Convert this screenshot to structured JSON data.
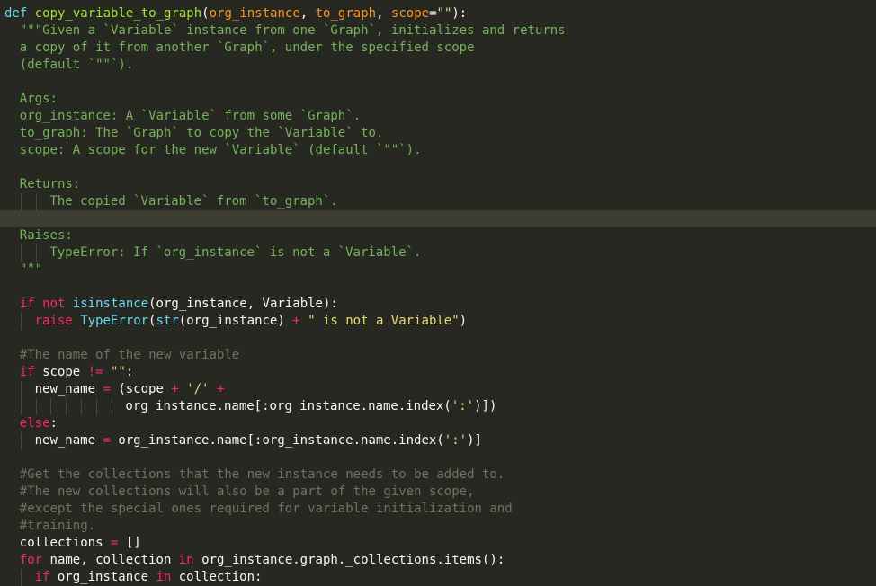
{
  "editor": {
    "language": "python",
    "theme_colors": {
      "background": "#272822",
      "active_line": "#3e3d32",
      "text": "#f8f8f2",
      "keyword": "#f92672",
      "def": "#66d9ef",
      "function": "#a6e22e",
      "parameter": "#fd971f",
      "string": "#e6db74",
      "docstring": "#75b35a",
      "comment": "#75715e",
      "indent_guide": "#464741"
    },
    "active_line_index": 12,
    "lines": [
      {
        "indent": 0,
        "tokens": [
          [
            "def",
            "def"
          ],
          [
            "t",
            " "
          ],
          [
            "fn",
            "copy_variable_to_graph"
          ],
          [
            "t",
            "("
          ],
          [
            "param",
            "org_instance"
          ],
          [
            "t",
            ", "
          ],
          [
            "param",
            "to_graph"
          ],
          [
            "t",
            ", "
          ],
          [
            "param",
            "scope"
          ],
          [
            "t",
            "="
          ],
          [
            "str",
            "\"\""
          ],
          [
            "t",
            "):"
          ]
        ]
      },
      {
        "indent": 1,
        "tokens": [
          [
            "doc",
            "\"\"\"Given a `Variable` instance from one `Graph`, initializes and returns"
          ]
        ]
      },
      {
        "indent": 1,
        "tokens": [
          [
            "doc",
            "a copy of it from another `Graph`, under the specified scope"
          ]
        ]
      },
      {
        "indent": 1,
        "tokens": [
          [
            "doc",
            "(default `\"\"`)."
          ]
        ]
      },
      {
        "indent": 1,
        "tokens": []
      },
      {
        "indent": 1,
        "tokens": [
          [
            "doc",
            "Args:"
          ]
        ]
      },
      {
        "indent": 1,
        "tokens": [
          [
            "doc",
            "org_instance: A `Variable` from some `Graph`."
          ]
        ]
      },
      {
        "indent": 1,
        "tokens": [
          [
            "doc",
            "to_graph: The `Graph` to copy the `Variable` to."
          ]
        ]
      },
      {
        "indent": 1,
        "tokens": [
          [
            "doc",
            "scope: A scope for the new `Variable` (default `\"\"`)."
          ]
        ]
      },
      {
        "indent": 1,
        "tokens": []
      },
      {
        "indent": 1,
        "tokens": [
          [
            "doc",
            "Returns:"
          ]
        ]
      },
      {
        "indent": 3,
        "tokens": [
          [
            "doc",
            "The copied `Variable` from `to_graph`."
          ]
        ]
      },
      {
        "indent": 0,
        "tokens": []
      },
      {
        "indent": 1,
        "tokens": [
          [
            "doc",
            "Raises:"
          ]
        ]
      },
      {
        "indent": 3,
        "tokens": [
          [
            "doc",
            "TypeError: If `org_instance` is not a `Variable`."
          ]
        ]
      },
      {
        "indent": 1,
        "tokens": [
          [
            "doc",
            "\"\"\""
          ]
        ]
      },
      {
        "indent": 1,
        "tokens": []
      },
      {
        "indent": 1,
        "tokens": [
          [
            "kw",
            "if"
          ],
          [
            "t",
            " "
          ],
          [
            "kw",
            "not"
          ],
          [
            "t",
            " "
          ],
          [
            "bi",
            "isinstance"
          ],
          [
            "t",
            "(org_instance, Variable):"
          ]
        ]
      },
      {
        "indent": 2,
        "tokens": [
          [
            "kw",
            "raise"
          ],
          [
            "t",
            " "
          ],
          [
            "bi",
            "TypeError"
          ],
          [
            "t",
            "("
          ],
          [
            "bi",
            "str"
          ],
          [
            "t",
            "(org_instance) "
          ],
          [
            "kw",
            "+"
          ],
          [
            "t",
            " "
          ],
          [
            "str",
            "\" is not a Variable\""
          ],
          [
            "t",
            ")"
          ]
        ]
      },
      {
        "indent": 1,
        "tokens": []
      },
      {
        "indent": 1,
        "tokens": [
          [
            "cm",
            "#The name of the new variable"
          ]
        ]
      },
      {
        "indent": 1,
        "tokens": [
          [
            "kw",
            "if"
          ],
          [
            "t",
            " scope "
          ],
          [
            "kw",
            "!="
          ],
          [
            "t",
            " "
          ],
          [
            "str",
            "\"\""
          ],
          [
            "t",
            ":"
          ]
        ]
      },
      {
        "indent": 2,
        "tokens": [
          [
            "t",
            "new_name "
          ],
          [
            "kw",
            "="
          ],
          [
            "t",
            " (scope "
          ],
          [
            "kw",
            "+"
          ],
          [
            "t",
            " "
          ],
          [
            "str",
            "'/'"
          ],
          [
            "t",
            " "
          ],
          [
            "kw",
            "+"
          ]
        ]
      },
      {
        "indent": 8,
        "tokens": [
          [
            "t",
            "org_instance.name[:org_instance.name.index("
          ],
          [
            "str",
            "':'"
          ],
          [
            "t",
            ")])"
          ]
        ]
      },
      {
        "indent": 1,
        "tokens": [
          [
            "kw",
            "else"
          ],
          [
            "t",
            ":"
          ]
        ]
      },
      {
        "indent": 2,
        "tokens": [
          [
            "t",
            "new_name "
          ],
          [
            "kw",
            "="
          ],
          [
            "t",
            " org_instance.name[:org_instance.name.index("
          ],
          [
            "str",
            "':'"
          ],
          [
            "t",
            ")]"
          ]
        ]
      },
      {
        "indent": 1,
        "tokens": []
      },
      {
        "indent": 1,
        "tokens": [
          [
            "cm",
            "#Get the collections that the new instance needs to be added to."
          ]
        ]
      },
      {
        "indent": 1,
        "tokens": [
          [
            "cm",
            "#The new collections will also be a part of the given scope,"
          ]
        ]
      },
      {
        "indent": 1,
        "tokens": [
          [
            "cm",
            "#except the special ones required for variable initialization and"
          ]
        ]
      },
      {
        "indent": 1,
        "tokens": [
          [
            "cm",
            "#training."
          ]
        ]
      },
      {
        "indent": 1,
        "tokens": [
          [
            "t",
            "collections "
          ],
          [
            "kw",
            "="
          ],
          [
            "t",
            " []"
          ]
        ]
      },
      {
        "indent": 1,
        "tokens": [
          [
            "kw",
            "for"
          ],
          [
            "t",
            " name, collection "
          ],
          [
            "kw",
            "in"
          ],
          [
            "t",
            " org_instance.graph._collections.items():"
          ]
        ]
      },
      {
        "indent": 2,
        "tokens": [
          [
            "kw",
            "if"
          ],
          [
            "t",
            " org_instance "
          ],
          [
            "kw",
            "in"
          ],
          [
            "t",
            " collection:"
          ]
        ]
      }
    ]
  }
}
